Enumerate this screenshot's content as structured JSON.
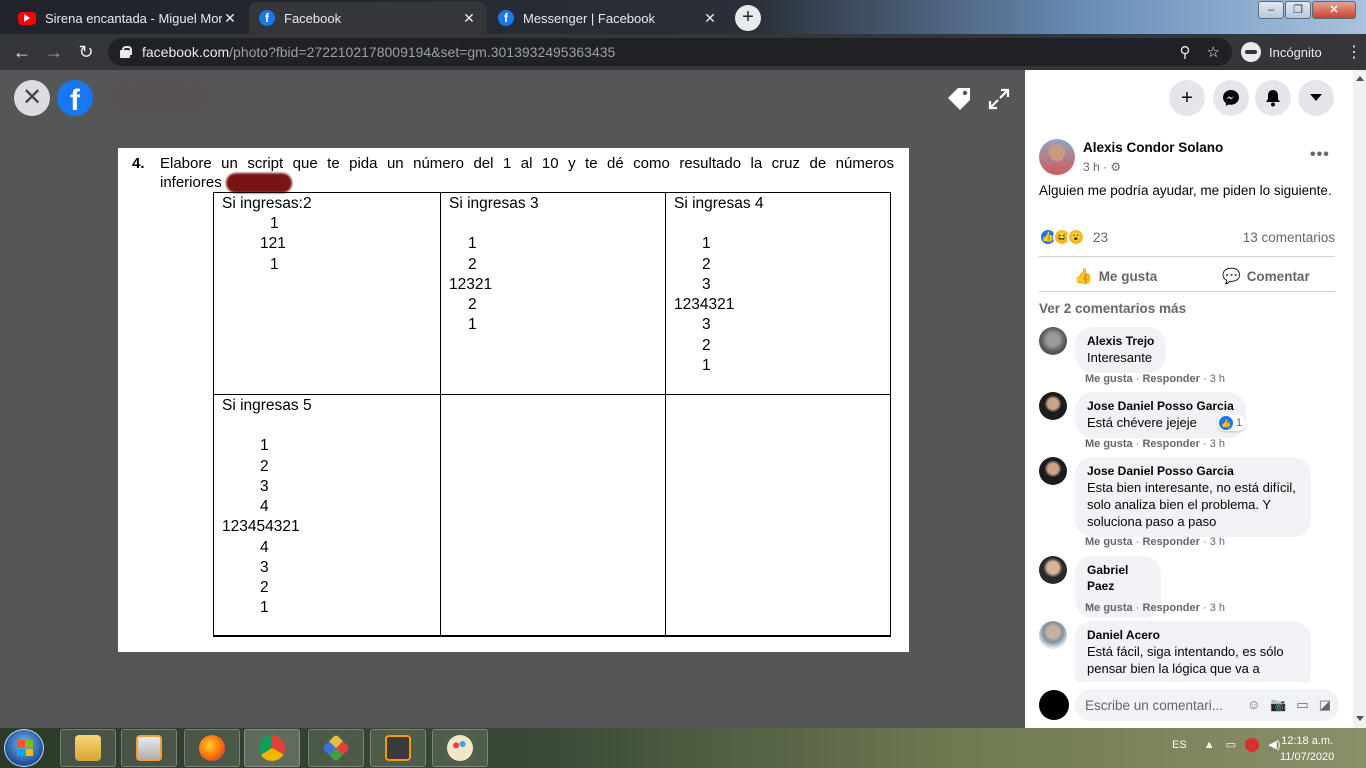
{
  "browser": {
    "tabs": [
      {
        "title": "Sirena encantada - Miguel Moral",
        "favicon": "youtube-icon",
        "active": false
      },
      {
        "title": "Facebook",
        "favicon": "facebook-icon",
        "active": true
      },
      {
        "title": "Messenger | Facebook",
        "favicon": "facebook-icon",
        "active": false
      }
    ],
    "url_domain": "facebook.com",
    "url_path": "/photo?fbid=2722102178009194&set=gm.3013932495363435",
    "profile_label": "Incógnito"
  },
  "photo": {
    "question_number": "4.",
    "question_line1": "Elabore un script que te pida un número del 1 al 10 y te dé como resultado la cruz de números",
    "question_line2": "inferiores",
    "cells": [
      {
        "header": "Si ingresas:2",
        "lines": [
          "1",
          "121",
          "1"
        ]
      },
      {
        "header": "Si ingresas 3",
        "lines": [
          "1",
          "2",
          "12321",
          "2",
          "1"
        ]
      },
      {
        "header": "Si ingresas 4",
        "lines": [
          "1",
          "2",
          "3",
          "1234321",
          "3",
          "2",
          "1"
        ]
      },
      {
        "header": "Si ingresas 5",
        "lines": [
          "1",
          "2",
          "3",
          "4",
          "123454321",
          "4",
          "3",
          "2",
          "1"
        ]
      }
    ]
  },
  "post": {
    "author": "Alexis Condor Solano",
    "time": "3 h ·",
    "text": "Alguien me podría ayudar, me piden lo siguiente.",
    "reaction_count": "23",
    "comment_count": "13 comentarios",
    "like_label": "Me gusta",
    "comment_label": "Comentar",
    "more_comments": "Ver 2 comentarios más"
  },
  "comments": [
    {
      "name": "Alexis Trejo",
      "text": "Interesante",
      "like": "Me gusta",
      "reply": "Responder",
      "time": "3 h"
    },
    {
      "name": "Jose Daniel Posso Garcia",
      "text": "Está chévere jejeje",
      "like": "Me gusta",
      "reply": "Responder",
      "time": "3 h",
      "likes": "1"
    },
    {
      "name": "Jose Daniel Posso Garcia",
      "text": "Esta bien interesante, no está difícil, solo analiza bien el problema. Y soluciona paso a paso",
      "like": "Me gusta",
      "reply": "Responder",
      "time": "3 h"
    },
    {
      "name": "Gabriel Paez",
      "text": ".",
      "like": "Me gusta",
      "reply": "Responder",
      "time": "3 h"
    },
    {
      "name": "Daniel Acero",
      "text": "Está fácil, siga intentando, es sólo pensar bien la lógica que va a",
      "like": "",
      "reply": "",
      "time": ""
    }
  ],
  "comment_input_placeholder": "Escribe un comentari...",
  "taskbar": {
    "language": "ES",
    "time": "12:18 a.m.",
    "date": "11/07/2020"
  },
  "colors": {
    "facebook_blue": "#1877f2",
    "viewer_bg": "#545658",
    "chrome_toolbar": "#35363a"
  }
}
